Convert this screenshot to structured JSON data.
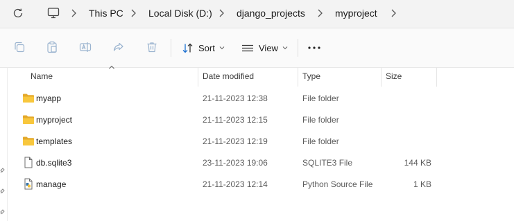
{
  "address_bar": {
    "breadcrumbs": [
      "This PC",
      "Local Disk (D:)",
      "django_projects",
      "myproject"
    ],
    "icons": [
      "refresh-icon",
      "computer-icon",
      "chevron-right-icon"
    ]
  },
  "toolbar": {
    "sort_label": "Sort",
    "view_label": "View",
    "icons": [
      "copy-icon",
      "paste-icon",
      "rename-icon",
      "share-icon",
      "delete-icon",
      "sort-icon",
      "view-icon",
      "more-icon"
    ]
  },
  "columns": [
    "Name",
    "Date modified",
    "Type",
    "Size"
  ],
  "files": [
    {
      "name": "myapp",
      "date": "21-11-2023 12:38",
      "type": "File folder",
      "size": "",
      "icon": "folder-icon"
    },
    {
      "name": "myproject",
      "date": "21-11-2023 12:15",
      "type": "File folder",
      "size": "",
      "icon": "folder-icon"
    },
    {
      "name": "templates",
      "date": "21-11-2023 12:19",
      "type": "File folder",
      "size": "",
      "icon": "folder-icon"
    },
    {
      "name": "db.sqlite3",
      "date": "23-11-2023 19:06",
      "type": "SQLITE3 File",
      "size": "144 KB",
      "icon": "file-icon"
    },
    {
      "name": "manage",
      "date": "21-11-2023 12:14",
      "type": "Python Source File",
      "size": "1 KB",
      "icon": "python-file-icon"
    }
  ],
  "colors": {
    "folder": "#f8c73d",
    "folder_dark": "#e4a92b",
    "accent": "#1a6fd1",
    "disabled_icon": "#9ab3cf"
  }
}
